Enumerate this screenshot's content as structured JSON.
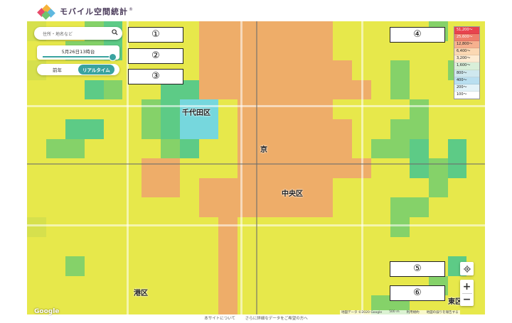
{
  "header": {
    "logo_text": "モバイル空間統計",
    "logo_mark": "®",
    "logo_colors": [
      "#e84a6a",
      "#f6b33b",
      "#5fb8e0",
      "#6fc36f"
    ]
  },
  "search": {
    "placeholder": "住所・地名など",
    "icon": "search-icon"
  },
  "time": {
    "label": "5月26日13時台",
    "slider_position": 0.95
  },
  "mode_toggle": {
    "past_label": "前年",
    "live_label": "リアルタイム",
    "selected": "リアルタイム"
  },
  "callouts": [
    "①",
    "②",
    "③",
    "④",
    "⑤",
    "⑥"
  ],
  "legend": {
    "items": [
      {
        "label": "51,200〜",
        "color": "#e8434e"
      },
      {
        "label": "25,600〜",
        "color": "#ee7f6c"
      },
      {
        "label": "12,800〜",
        "color": "#f6b08e"
      },
      {
        "label": "6,400〜",
        "color": "#fbd8b3"
      },
      {
        "label": "3,200〜",
        "color": "#fdebd2"
      },
      {
        "label": "1,600〜",
        "color": "#d9efd9"
      },
      {
        "label": "800〜",
        "color": "#cfe8ef"
      },
      {
        "label": "400〜",
        "color": "#b9dff0"
      },
      {
        "label": "200〜",
        "color": "#e3f3f8"
      },
      {
        "label": "100〜",
        "color": "#ffffff"
      }
    ]
  },
  "map_labels": {
    "chiyoda": "千代田区",
    "chuo": "中央区",
    "minato": "港区",
    "koto_partial": "東区",
    "kyo": "京"
  },
  "map_colors": {
    "O": "#f0a86a",
    "Y": "#e8e84a",
    "y": "#d6e04c",
    "G": "#7ed06a",
    "g": "#52c98a",
    "C": "#6ed6e8",
    "T": "#4fc9b0"
  },
  "heat_rows": [
    "yYYGgYYYYOOOOOOOYYYYYGYY",
    "YYGGgYYYYOOOOOOOYYYYYYYY",
    "yYYYYYYYYOOOOOOOOYYGYYGY",
    "YYYgGYYggOOOOOOOOOYGYYYY",
    "YYYYYYGgCCYOOOOOYYYYGYYY",
    "YYggYYGgCCYOOOOOOYYGGYYY",
    "YGGYYYYGgYYOOOOOOYGGgYgY",
    "YYYYYYOOYYYOOOOOOOYYgGgY",
    "YYYYYYOOYOOOOOOOYYYYYGYY",
    "YYYYYYYYYOOOOOOOYYYGGYYY",
    "yYYYYYYYYYOYYYYYYYYGYYYY",
    "YYYYYYYYYYOYYYYYYYYYYYYY",
    "YYGYYYYYYYOYYYYYYYYYYYgY",
    "YYYYYYYYYYOYYYYYYYYYYGYY",
    "YYYYYYYYYYOYYYYYYYGGYYYY"
  ],
  "controls": {
    "locate_icon": "locate-icon",
    "zoom_in": "+",
    "zoom_out": "−"
  },
  "attribution": {
    "google": "Google",
    "map_data": "地図データ ©2020 Google",
    "scale": "500 m",
    "terms": "利用規約",
    "report": "地図の誤りを報告する"
  },
  "footer": {
    "about": "本サイトについて",
    "more_data": "さらに詳細なデータをご希望の方へ"
  }
}
